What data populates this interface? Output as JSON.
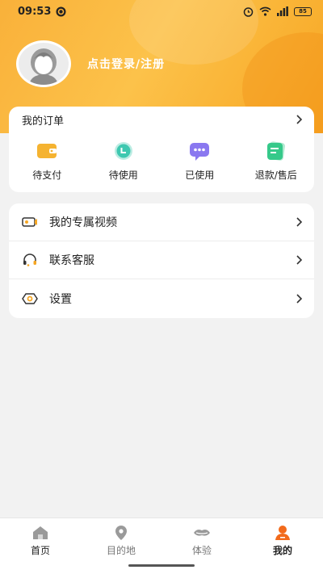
{
  "status_bar": {
    "time": "09:53",
    "battery": "85"
  },
  "profile": {
    "login_text": "点击登录/注册"
  },
  "orders": {
    "title": "我的订单",
    "items": [
      {
        "label": "待支付",
        "icon": "wallet-icon",
        "color": "#f5b331"
      },
      {
        "label": "待使用",
        "icon": "clock-icon",
        "color": "#3ec8b0"
      },
      {
        "label": "已使用",
        "icon": "chat-bubble-icon",
        "color": "#8a78f0"
      },
      {
        "label": "退款/售后",
        "icon": "refund-card-icon",
        "color": "#36c98a"
      }
    ]
  },
  "menu": {
    "items": [
      {
        "label": "我的专属视频",
        "icon": "video-icon"
      },
      {
        "label": "联系客服",
        "icon": "headset-icon"
      },
      {
        "label": "设置",
        "icon": "settings-icon"
      }
    ]
  },
  "bottom_nav": {
    "items": [
      {
        "label": "首页",
        "icon": "home-icon"
      },
      {
        "label": "目的地",
        "icon": "location-pin-icon"
      },
      {
        "label": "体验",
        "icon": "experience-icon"
      },
      {
        "label": "我的",
        "icon": "user-icon",
        "active": true
      }
    ],
    "accent": "#f26a1b"
  }
}
